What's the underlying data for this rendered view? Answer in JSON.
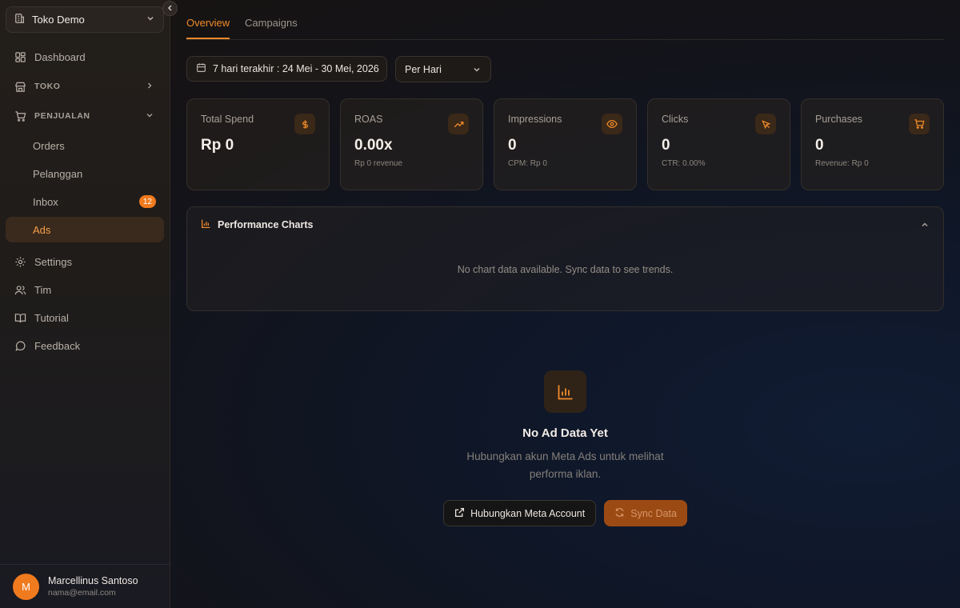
{
  "store": {
    "name": "Toko Demo"
  },
  "nav": {
    "dashboard": "Dashboard",
    "toko": "TOKO",
    "penjualan": "PENJUALAN",
    "orders": "Orders",
    "pelanggan": "Pelanggan",
    "inbox": "Inbox",
    "inbox_badge": "12",
    "ads": "Ads",
    "settings": "Settings",
    "tim": "Tim",
    "tutorial": "Tutorial",
    "feedback": "Feedback"
  },
  "user": {
    "initial": "M",
    "name": "Marcellinus Santoso",
    "email": "nama@email.com"
  },
  "tabs": [
    {
      "label": "Overview",
      "active": true
    },
    {
      "label": "Campaigns",
      "active": false
    }
  ],
  "filters": {
    "date_range": "7 hari terakhir : 24 Mei - 30 Mei, 2026",
    "period": "Per Hari"
  },
  "metrics": [
    {
      "label": "Total Spend",
      "value": "Rp 0",
      "sub": "",
      "icon": "dollar-icon"
    },
    {
      "label": "ROAS",
      "value": "0.00x",
      "sub": "Rp 0 revenue",
      "icon": "trending-up-icon"
    },
    {
      "label": "Impressions",
      "value": "0",
      "sub": "CPM: Rp 0",
      "icon": "eye-icon"
    },
    {
      "label": "Clicks",
      "value": "0",
      "sub": "CTR: 0.00%",
      "icon": "cursor-icon"
    },
    {
      "label": "Purchases",
      "value": "0",
      "sub": "Revenue: Rp 0",
      "icon": "cart-icon"
    }
  ],
  "performance": {
    "title": "Performance Charts",
    "empty": "No chart data available. Sync data to see trends."
  },
  "empty_state": {
    "title": "No Ad Data Yet",
    "description": "Hubungkan akun Meta Ads untuk melihat performa iklan.",
    "connect_label": "Hubungkan Meta Account",
    "sync_label": "Sync Data"
  },
  "colors": {
    "accent": "#f08a2a",
    "badge": "#f07a1e",
    "sync_button": "#9c4a14"
  }
}
